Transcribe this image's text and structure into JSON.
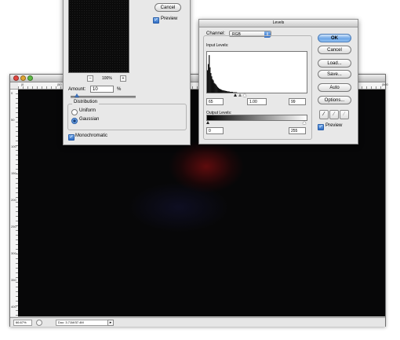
{
  "document": {
    "ruler_h_ticks": [
      "|0",
      "|50",
      "|100",
      "|150",
      "|200",
      "|250",
      "|300",
      "|350",
      "|400",
      "|450",
      "|500"
    ],
    "ruler_v_ticks": [
      "0",
      "50",
      "100",
      "150",
      "200",
      "250",
      "300",
      "350",
      "400"
    ],
    "zoom": "66.67%",
    "doc_info": "Doc: 3.71M/37.4M"
  },
  "add_noise": {
    "cancel_label": "Cancel",
    "preview_label": "Preview",
    "preview_checked": true,
    "zoom_minus": "–",
    "zoom_value": "100%",
    "zoom_plus": "+",
    "amount_label": "Amount:",
    "amount_value": "10",
    "amount_unit": "%",
    "amount_fraction": 0.1,
    "distribution_label": "Distribution",
    "uniform_label": "Uniform",
    "gaussian_label": "Gaussian",
    "selected_distribution": "Gaussian",
    "monochromatic_label": "Monochromatic",
    "monochromatic_checked": true
  },
  "levels": {
    "title": "Levels",
    "channel_label": "Channel:",
    "channel_value": "RGB",
    "input_levels_label": "Input Levels:",
    "input_black": "65",
    "input_gamma": "1.00",
    "input_white": "99",
    "output_levels_label": "Output Levels:",
    "output_black": "0",
    "output_white": "255",
    "ok_label": "OK",
    "cancel_label": "Cancel",
    "load_label": "Load...",
    "save_label": "Save...",
    "auto_label": "Auto",
    "options_label": "Options...",
    "preview_label": "Preview",
    "preview_checked": true,
    "eyedroppers": [
      "black-eyedropper-icon",
      "gray-eyedropper-icon",
      "white-eyedropper-icon"
    ],
    "histogram": [
      0.55,
      0.7,
      0.92,
      0.62,
      0.48,
      0.4,
      0.33,
      0.3,
      0.24,
      0.22,
      0.2,
      0.17,
      0.14,
      0.12,
      0.1,
      0.09,
      0.08,
      0.07,
      0.06,
      0.06,
      0.05,
      0.05,
      0.04,
      0.04,
      0.03,
      0.03,
      0.03,
      0.02,
      0.02,
      0.02,
      0.02,
      0.01,
      0.01,
      0.01,
      0.01,
      0.01,
      0.0,
      0.0,
      0.0,
      0.0
    ]
  },
  "colors": {
    "canvas_base": "#070708",
    "accent_blue": "#3a78d0",
    "glow_red": "#6e0c0e"
  }
}
